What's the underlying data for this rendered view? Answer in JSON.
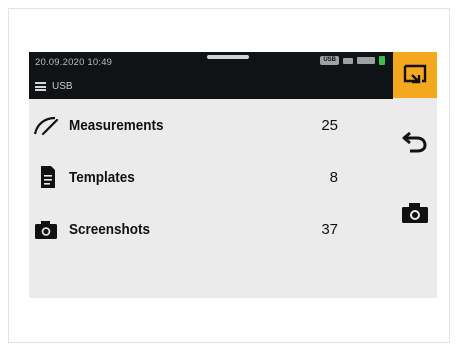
{
  "status_bar": {
    "datetime": "20.09.2020  10:49",
    "usb_badge": "USB"
  },
  "breadcrumb": {
    "label": "USB"
  },
  "items": [
    {
      "label": "Measurements",
      "count": "25",
      "icon": "gauge-icon"
    },
    {
      "label": "Templates",
      "count": "8",
      "icon": "document-icon"
    },
    {
      "label": "Screenshots",
      "count": "37",
      "icon": "camera-icon"
    }
  ],
  "sidebar": [
    {
      "icon": "export-icon",
      "active": true,
      "accent": "#f3a81d"
    },
    {
      "icon": "back-arrow-icon",
      "active": false
    },
    {
      "icon": "camera-icon",
      "active": false
    }
  ]
}
